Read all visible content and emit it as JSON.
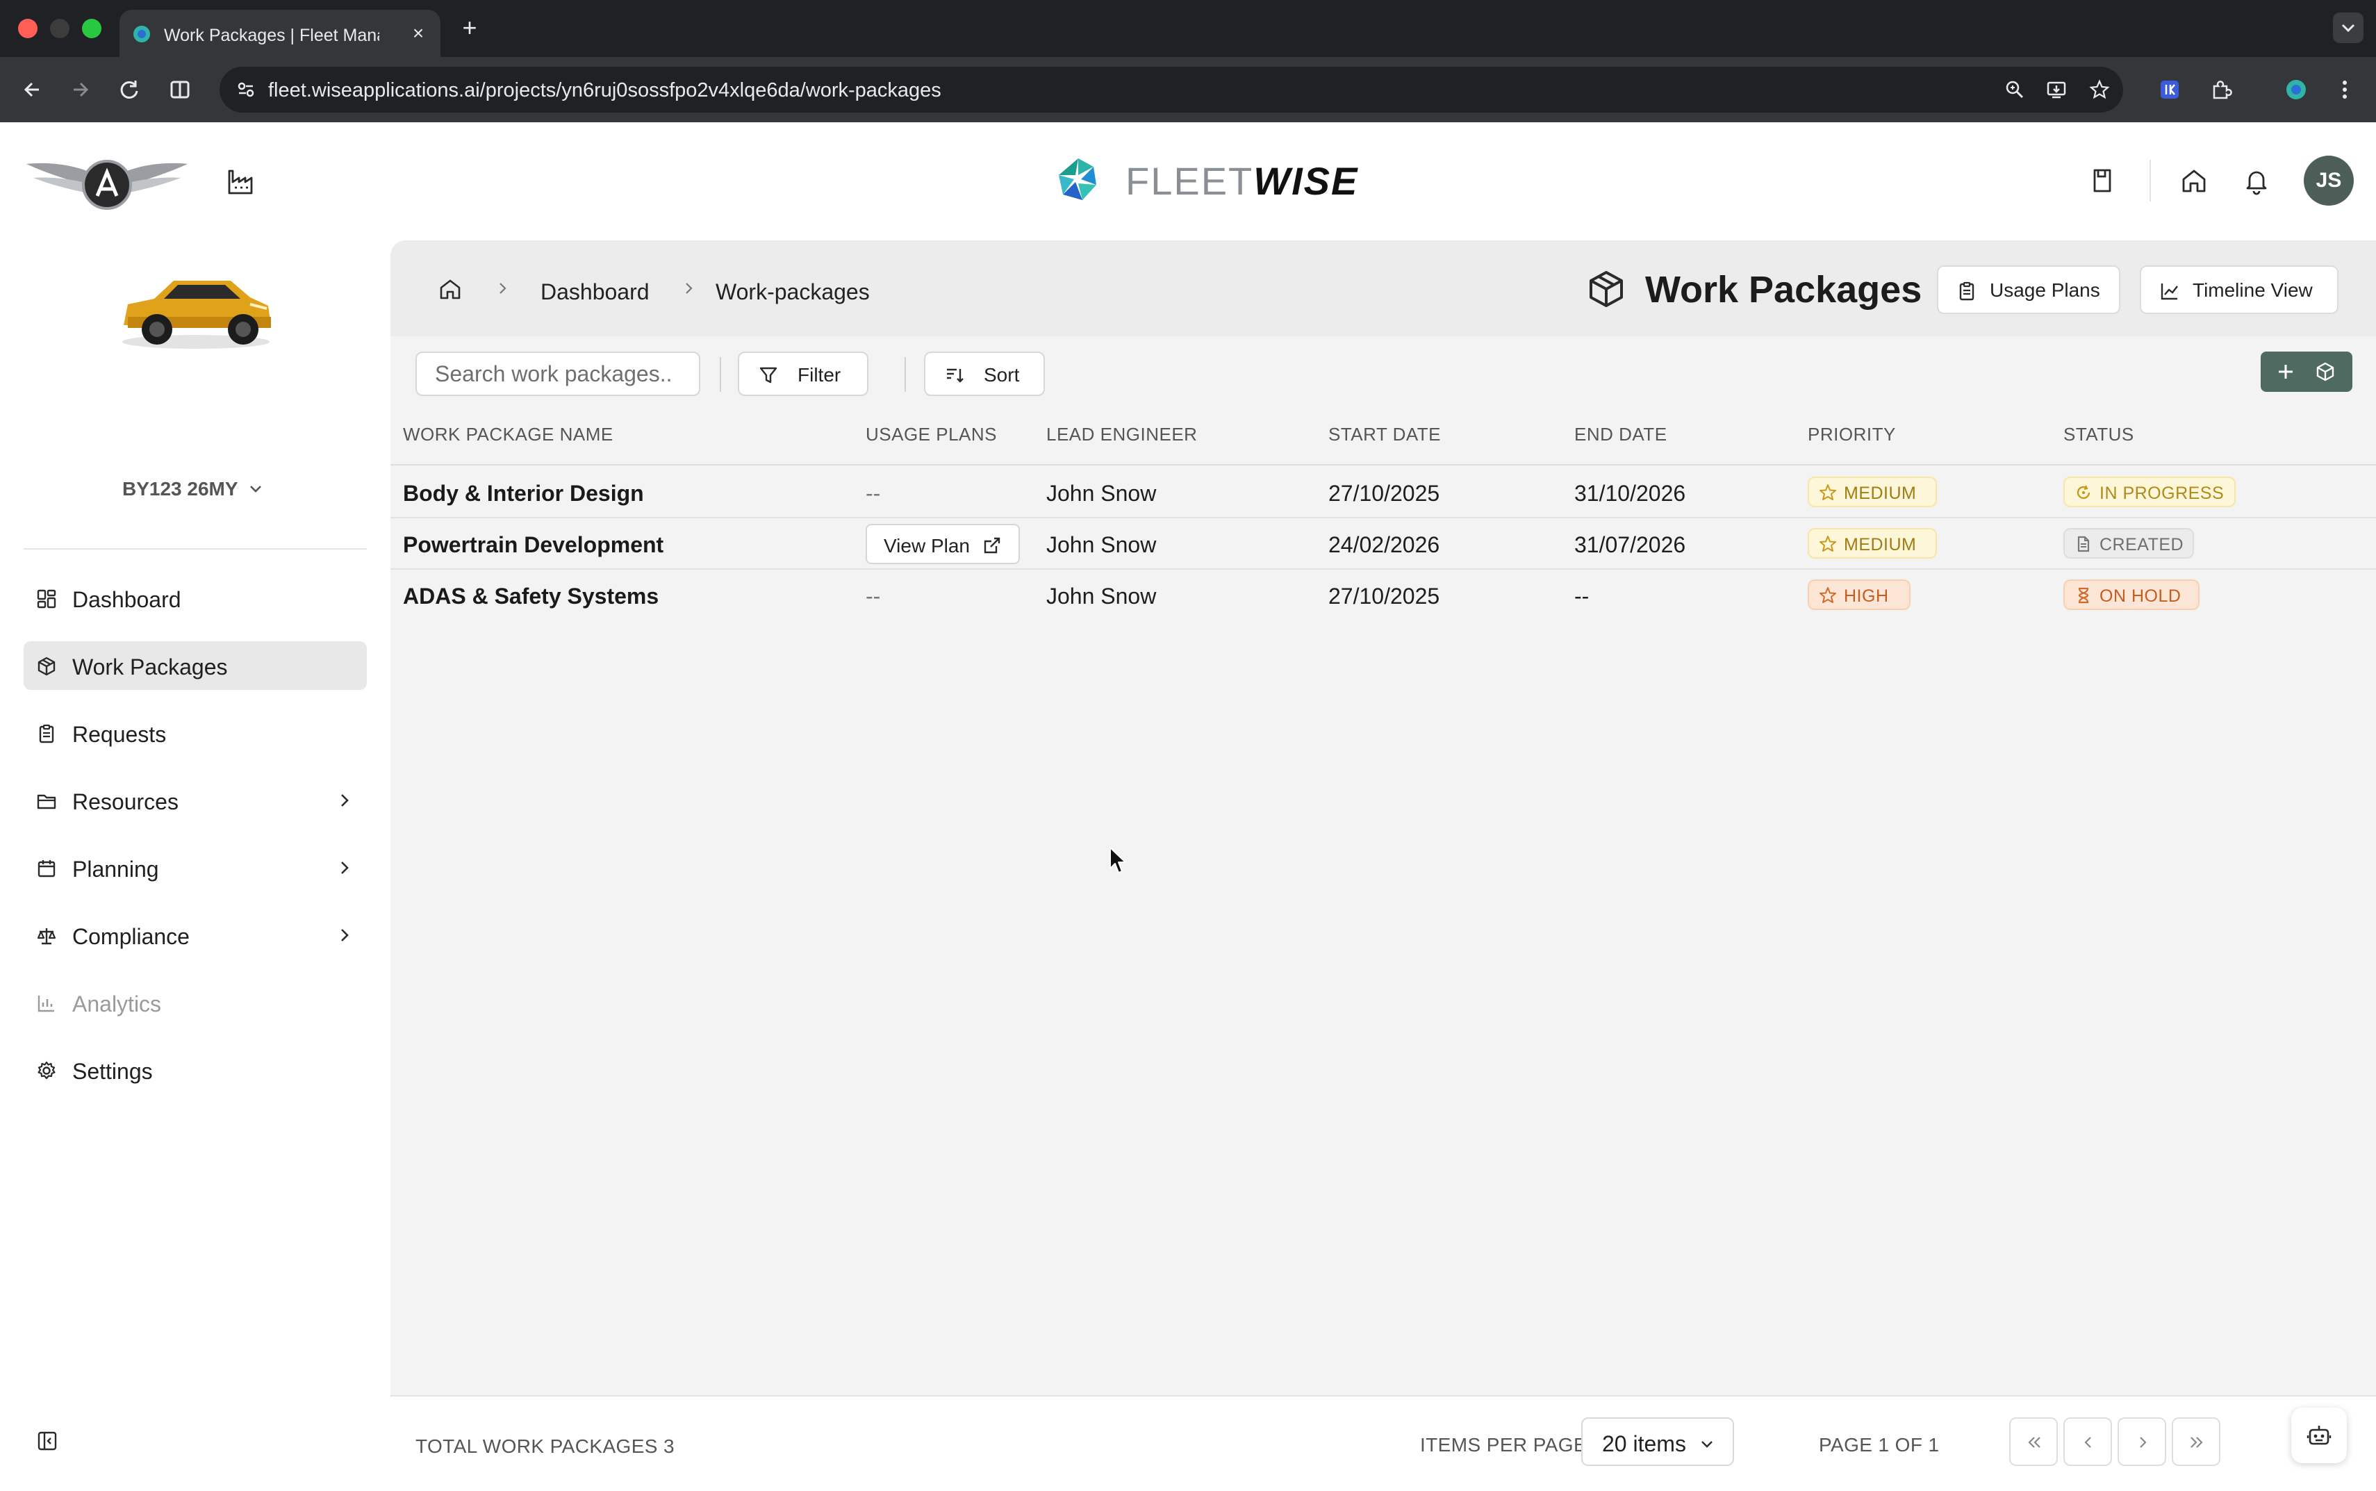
{
  "browser": {
    "tab_title": "Work Packages | Fleet Manag",
    "url": "fleet.wiseapplications.ai/projects/yn6ruj0sossfpo2v4xlqe6da/work-packages"
  },
  "brand": {
    "logo_light": "FLEET",
    "logo_bold": "WISE"
  },
  "user": {
    "initials": "JS"
  },
  "vehicle": {
    "id": "BY123 26MY"
  },
  "sidebar": {
    "items": [
      {
        "label": "Dashboard",
        "icon": "dashboard-icon"
      },
      {
        "label": "Work Packages",
        "icon": "package-icon"
      },
      {
        "label": "Requests",
        "icon": "clipboard-icon"
      },
      {
        "label": "Resources",
        "icon": "folder-icon"
      },
      {
        "label": "Planning",
        "icon": "calendar-icon"
      },
      {
        "label": "Compliance",
        "icon": "scale-icon"
      },
      {
        "label": "Analytics",
        "icon": "bar-chart-icon"
      },
      {
        "label": "Settings",
        "icon": "gear-icon"
      }
    ]
  },
  "breadcrumb": {
    "items": [
      "Dashboard",
      "Work-packages"
    ]
  },
  "page": {
    "title": "Work Packages",
    "usage_plans_label": "Usage Plans",
    "timeline_view_label": "Timeline View"
  },
  "toolbar": {
    "search_placeholder": "Search work packages..",
    "filter_label": "Filter",
    "sort_label": "Sort"
  },
  "table": {
    "headers": [
      "WORK PACKAGE NAME",
      "USAGE PLANS",
      "LEAD ENGINEER",
      "START DATE",
      "END DATE",
      "PRIORITY",
      "STATUS"
    ],
    "rows": [
      {
        "name": "Body & Interior Design",
        "usage_plans": "--",
        "lead_engineer": "John Snow",
        "start_date": "27/10/2025",
        "end_date": "31/10/2026",
        "priority": "MEDIUM",
        "status": "IN PROGRESS"
      },
      {
        "name": "Powertrain Development",
        "usage_plans": "View Plan",
        "lead_engineer": "John Snow",
        "start_date": "24/02/2026",
        "end_date": "31/07/2026",
        "priority": "MEDIUM",
        "status": "CREATED"
      },
      {
        "name": "ADAS & Safety Systems",
        "usage_plans": "--",
        "lead_engineer": "John Snow",
        "start_date": "27/10/2025",
        "end_date": "--",
        "priority": "HIGH",
        "status": "ON HOLD"
      }
    ]
  },
  "footer": {
    "total_label": "TOTAL WORK PACKAGES 3",
    "items_per_page_label": "ITEMS PER PAGE",
    "items_per_page_value": "20 items",
    "page_label": "PAGE 1 OF 1"
  },
  "colors": {
    "accent": "#4f6a61",
    "medium": "#a07c15",
    "high": "#c25e24"
  }
}
